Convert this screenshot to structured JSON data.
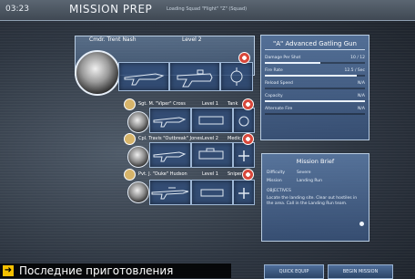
{
  "topbar": {
    "time": "03:23",
    "title": "MISSION PREP",
    "subtitle": "Loading Squad \"Flight\" \"Z\" (Squad)"
  },
  "squad": {
    "leader_name": "Cmdr. Trent Nash",
    "leader_level": "Level 2",
    "members": [
      {
        "name": "Sgt. M. \"Viper\" Cross",
        "level": "Level 1",
        "tag": "Tank"
      },
      {
        "name": "Cpl. Travis \"Outbreak\" Jones",
        "level": "Level 2",
        "tag": "Medic"
      },
      {
        "name": "Pvt. J. \"Duke\" Hudson",
        "level": "Level 1",
        "tag": "Sniper"
      }
    ]
  },
  "weapon_panel": {
    "title": "\"A\" Advanced Gatling Gun",
    "stats": [
      {
        "label": "Damage Per Shot",
        "value": "10 / 12",
        "fill": 0.55
      },
      {
        "label": "Fire Rate",
        "value": "12.5 / Sec",
        "fill": 0.92
      },
      {
        "label": "Reload Speed",
        "value": "N/A",
        "fill": 0.0
      },
      {
        "label": "Capacity",
        "value": "N/A",
        "fill": 1.0
      },
      {
        "label": "Alternate Fire",
        "value": "N/A",
        "fill": 0.0
      }
    ]
  },
  "briefing": {
    "title": "Mission Brief",
    "difficulty_label": "Difficulty",
    "difficulty_value": "Severe",
    "mission_label": "Mission",
    "mission_value": "Landing Run",
    "objectives_label": "OBJECTIVES",
    "objectives_text": "Locate the landing site. Clear out hostiles in the area. Call in the Landing Run team."
  },
  "buttons": {
    "left": "QUICK EQUIP",
    "right": "BEGIN MISSION"
  },
  "caption": {
    "icon": "arrow-right-icon",
    "text": "Последние приготовления"
  },
  "colors": {
    "panel": "#5a7aa6",
    "accent": "#f5c000"
  }
}
